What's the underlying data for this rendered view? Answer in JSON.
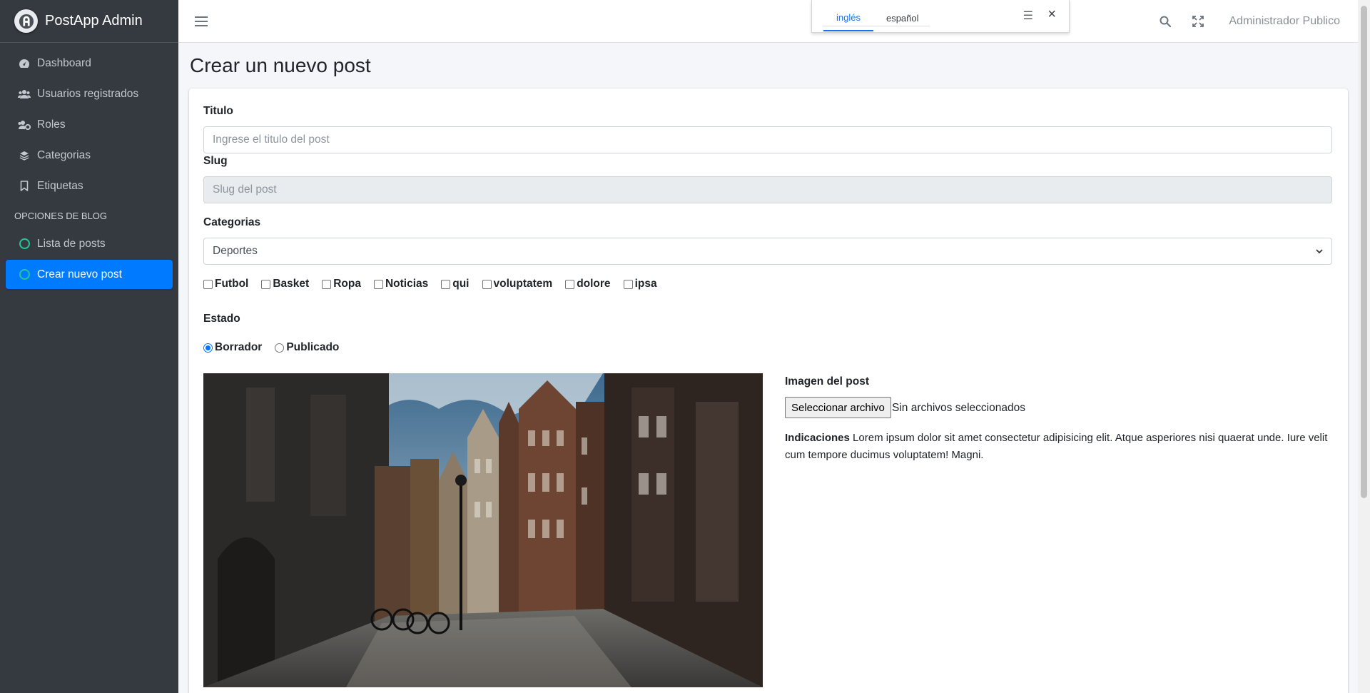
{
  "brand": {
    "name": "PostApp",
    "suffix": "Admin"
  },
  "sidebar": {
    "items": [
      {
        "label": "Dashboard",
        "icon": "tachometer-icon"
      },
      {
        "label": "Usuarios registrados",
        "icon": "users-icon"
      },
      {
        "label": "Roles",
        "icon": "users-cog-icon"
      },
      {
        "label": "Categorias",
        "icon": "layers-icon"
      },
      {
        "label": "Etiquetas",
        "icon": "bookmark-icon"
      }
    ],
    "section_header": "OPCIONES DE BLOG",
    "blog_items": [
      {
        "label": "Lista de posts",
        "icon": "circle-icon",
        "active": false
      },
      {
        "label": "Crear nuevo post",
        "icon": "circle-icon",
        "active": true
      }
    ]
  },
  "topbar": {
    "user": "Administrador Publico"
  },
  "translate": {
    "tab_1": "inglés",
    "tab_2": "español",
    "active_tab": "inglés"
  },
  "page": {
    "title": "Crear un nuevo post"
  },
  "form": {
    "title_label": "Titulo",
    "title_placeholder": "Ingrese el titulo del post",
    "slug_label": "Slug",
    "slug_placeholder": "Slug del post",
    "category_label": "Categorias",
    "category_value": "Deportes",
    "tags": [
      "Futbol",
      "Basket",
      "Ropa",
      "Noticias",
      "qui",
      "voluptatem",
      "dolore",
      "ipsa"
    ],
    "status_label": "Estado",
    "status_options": [
      "Borrador",
      "Publicado"
    ],
    "status_selected": "Borrador",
    "image_label": "Imagen del post",
    "file_button": "Seleccionar archivo",
    "file_status": "Sin archivos seleccionados",
    "notes_title": "Indicaciones",
    "notes_text": "Lorem ipsum dolor sit amet consectetur adipisicing elit. Atque asperiores nisi quaerat unde. Iure velit cum tempore ducimus voluptatem! Magni."
  },
  "colors": {
    "sidebar_bg": "#343a40",
    "active_bg": "#007bff",
    "accent": "#20c997"
  }
}
